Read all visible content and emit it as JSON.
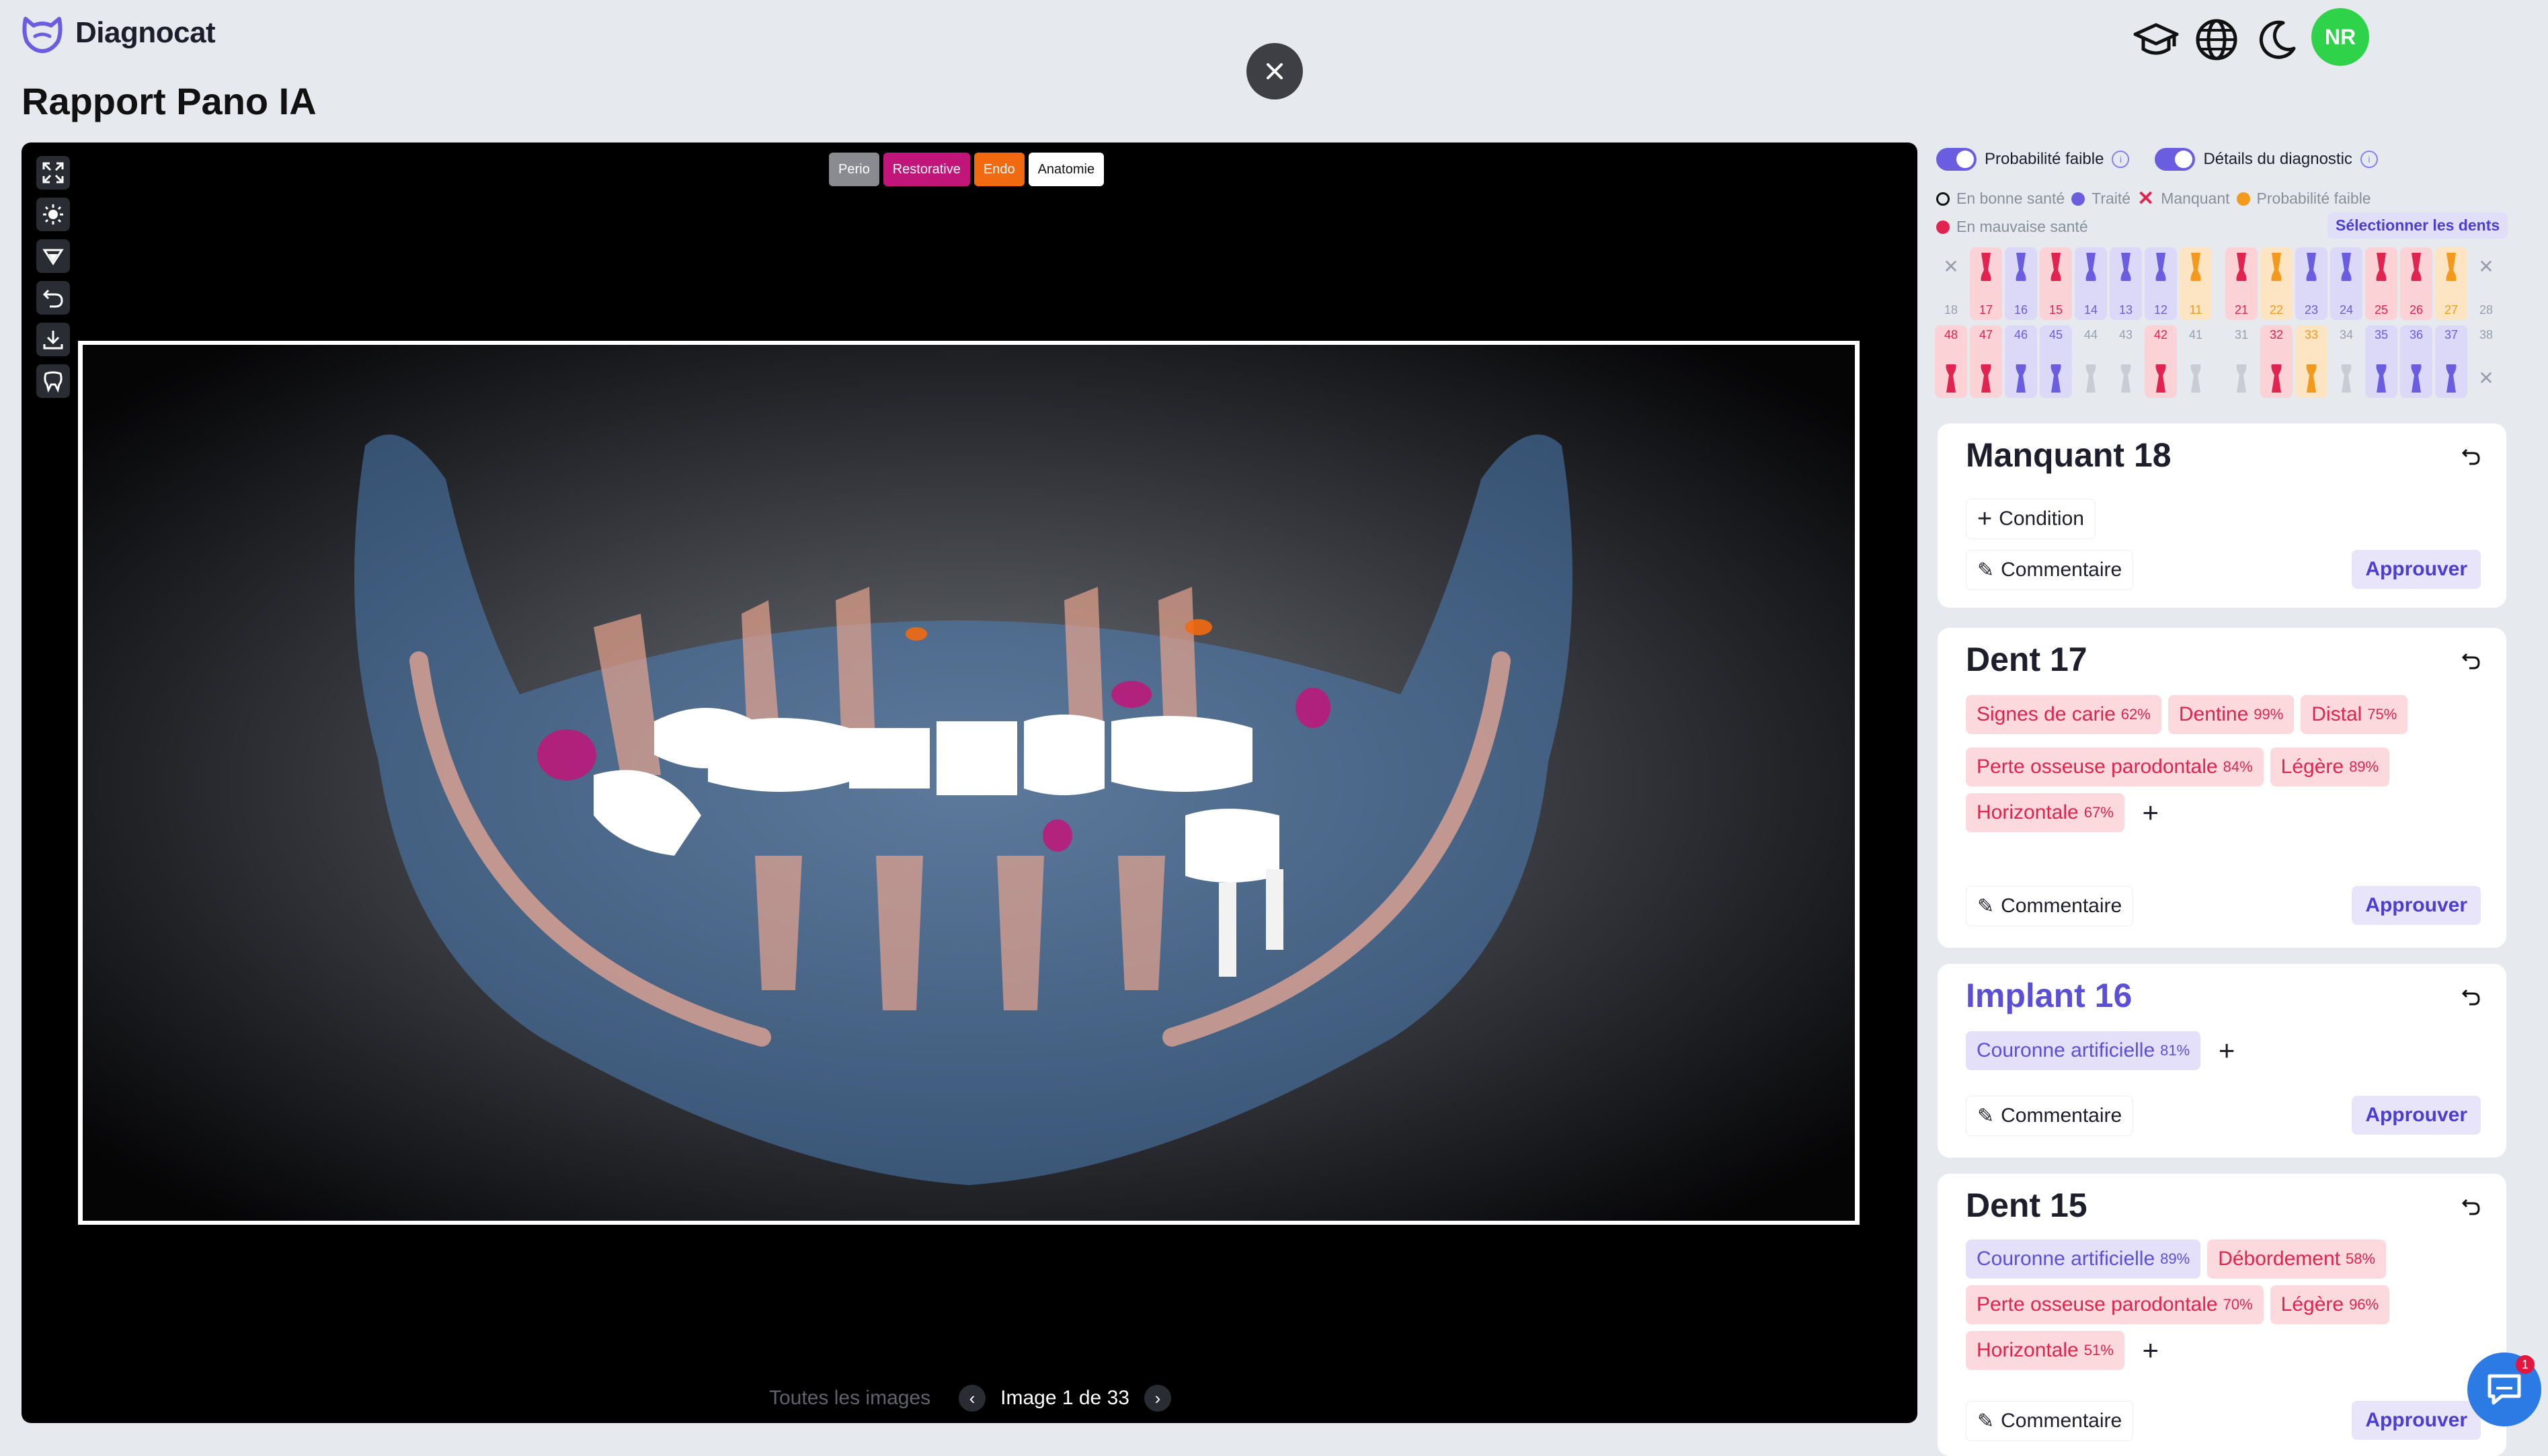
{
  "app": {
    "name": "Diagnocat",
    "page_title": "Rapport Pano IA",
    "avatar_initials": "NR"
  },
  "viewer": {
    "layers": [
      "Perio",
      "Restorative",
      "Endo",
      "Anatomie"
    ],
    "all_images_label": "Toutes les images",
    "page_counter": "Image 1 de 33"
  },
  "panel": {
    "toggle_low_prob": "Probabilité faible",
    "toggle_details": "Détails du diagnostic",
    "legend": {
      "healthy": "En bonne santé",
      "treated": "Traité",
      "missing": "Manquant",
      "low_prob": "Probabilité faible",
      "unhealthy": "En mauvaise santé"
    },
    "select_teeth": "Sélectionner les dents",
    "upper_teeth": [
      "18",
      "17",
      "16",
      "15",
      "14",
      "13",
      "12",
      "11",
      "21",
      "22",
      "23",
      "24",
      "25",
      "26",
      "27",
      "28"
    ],
    "lower_teeth": [
      "48",
      "47",
      "46",
      "45",
      "44",
      "43",
      "42",
      "41",
      "31",
      "32",
      "33",
      "34",
      "35",
      "36",
      "37",
      "38"
    ],
    "upper_status": [
      "missing",
      "unhealthy",
      "treated",
      "unhealthy",
      "treated",
      "treated",
      "treated",
      "lowprob",
      "unhealthy",
      "lowprob",
      "treated",
      "treated",
      "unhealthy",
      "unhealthy",
      "lowprob",
      "missing"
    ],
    "lower_status": [
      "unhealthy",
      "unhealthy",
      "treated",
      "treated",
      "healthy",
      "healthy",
      "unhealthy",
      "healthy",
      "healthy",
      "unhealthy",
      "lowprob",
      "healthy",
      "treated",
      "treated",
      "treated",
      "missing"
    ],
    "condition_label": "Condition",
    "comment_label": "Commentaire",
    "approve_label": "Approuver",
    "cards": [
      {
        "title": "Manquant 18",
        "findings": []
      },
      {
        "title": "Dent 17",
        "findings": [
          {
            "label": "Signes de carie",
            "pct": "62%"
          },
          {
            "label": "Dentine",
            "pct": "99%"
          },
          {
            "label": "Distal",
            "pct": "75%"
          },
          {
            "label": "Perte osseuse parodontale",
            "pct": "84%"
          },
          {
            "label": "Légère",
            "pct": "89%"
          },
          {
            "label": "Horizontale",
            "pct": "67%"
          }
        ]
      },
      {
        "title": "Implant 16",
        "findings": [
          {
            "label": "Couronne artificielle",
            "pct": "81%"
          }
        ]
      },
      {
        "title": "Dent 15",
        "findings": [
          {
            "label": "Couronne artificielle",
            "pct": "89%"
          },
          {
            "label": "Débordement",
            "pct": "58%"
          },
          {
            "label": "Perte osseuse parodontale",
            "pct": "70%"
          },
          {
            "label": "Légère",
            "pct": "96%"
          },
          {
            "label": "Horizontale",
            "pct": "51%"
          }
        ]
      }
    ]
  },
  "chat_badge": "1",
  "colors": {
    "accent": "#6b5de0",
    "unhealthy": "#e0234f",
    "treated": "#6b5de0",
    "lowprob": "#f39a1e",
    "restorative": "#c2157a",
    "endo": "#f26a10",
    "online": "#2ed34a"
  }
}
